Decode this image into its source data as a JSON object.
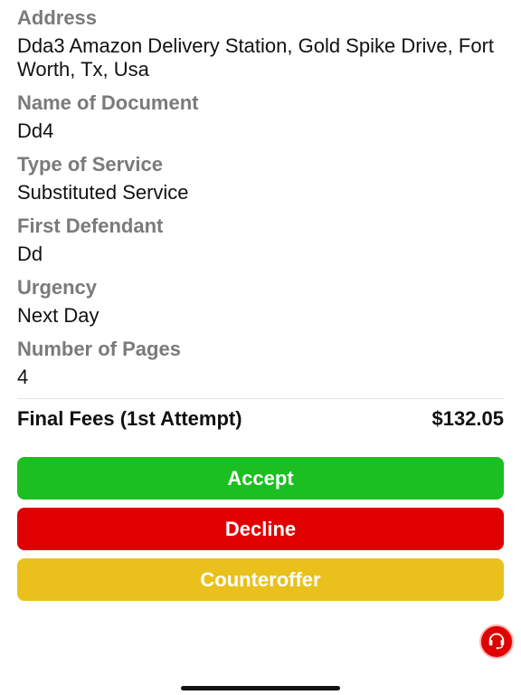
{
  "details": [
    {
      "label": "Address",
      "value": "Dda3 Amazon Delivery Station, Gold Spike Drive, Fort Worth, Tx, Usa"
    },
    {
      "label": "Name of Document",
      "value": "Dd4"
    },
    {
      "label": "Type of Service",
      "value": "Substituted Service"
    },
    {
      "label": "First Defendant",
      "value": "Dd"
    },
    {
      "label": "Urgency",
      "value": "Next Day"
    },
    {
      "label": "Number of Pages",
      "value": "4"
    }
  ],
  "fees": {
    "label": "Final Fees (1st Attempt)",
    "amount": "$132.05"
  },
  "actions": {
    "accept_label": "Accept",
    "decline_label": "Decline",
    "counteroffer_label": "Counteroffer"
  },
  "colors": {
    "accept": "#1bbf22",
    "decline": "#e00000",
    "counteroffer": "#eac01c",
    "label_gray": "#7a7a7a"
  },
  "icons": {
    "support": "headset-icon"
  }
}
